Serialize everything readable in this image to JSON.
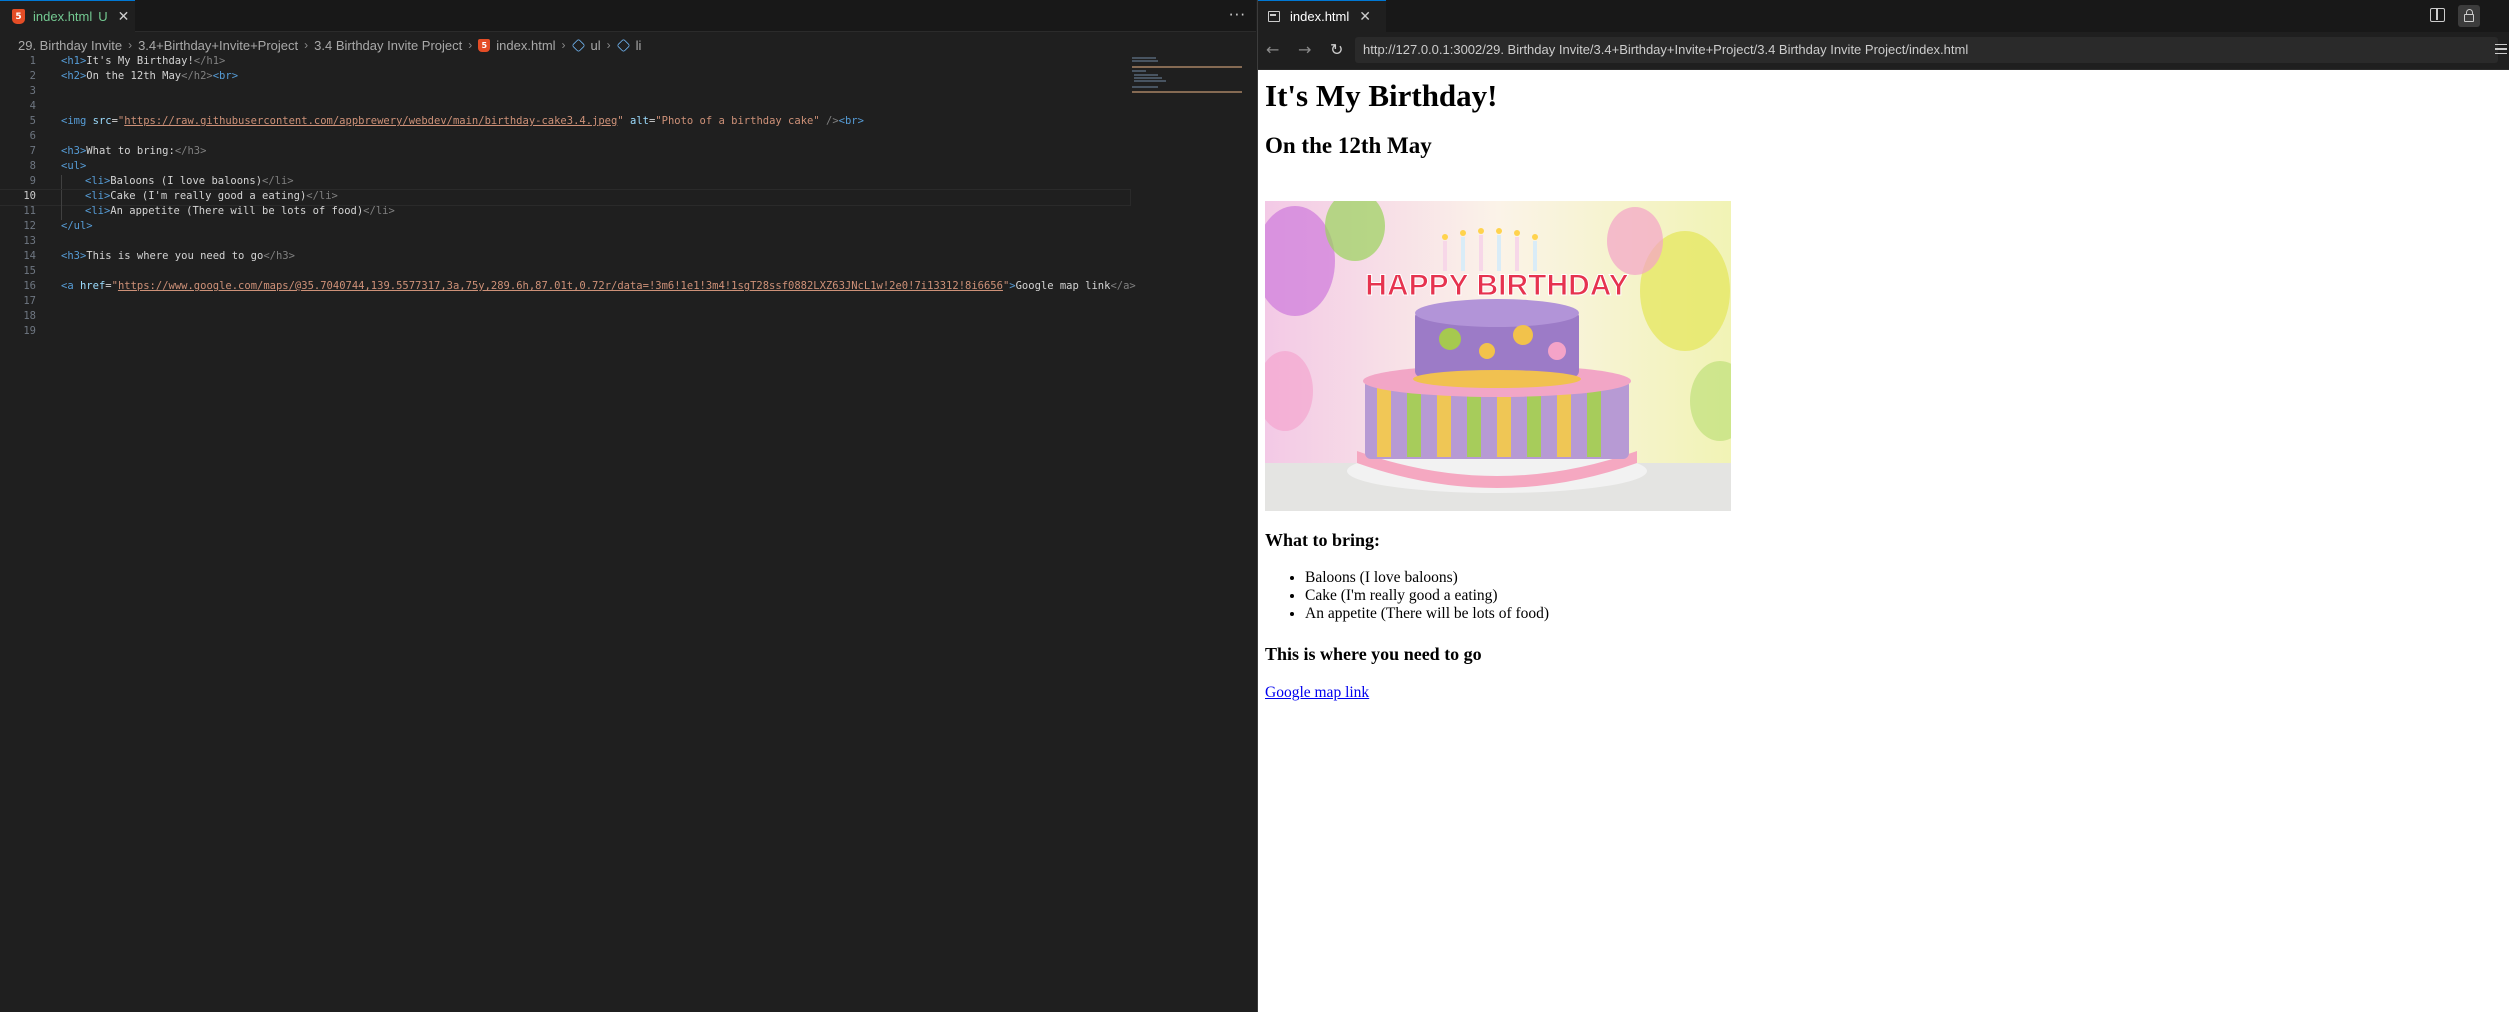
{
  "editor": {
    "tab_label": "index.html",
    "tab_badge": "U",
    "breadcrumb": [
      "29. Birthday Invite",
      "3.4+Birthday+Invite+Project",
      "3.4 Birthday Invite Project",
      "index.html",
      "ul",
      "li"
    ],
    "line_numbers": [
      "1",
      "2",
      "3",
      "4",
      "5",
      "6",
      "7",
      "8",
      "9",
      "10",
      "11",
      "12",
      "13",
      "14",
      "15",
      "16",
      "17",
      "18",
      "19"
    ],
    "current_line": 10,
    "lines": {
      "l1_text": "It's My Birthday!",
      "l2_text": "On the 12th May",
      "l5_src": "https://raw.githubusercontent.com/appbrewery/webdev/main/birthday-cake3.4.jpeg",
      "l5_alt": "Photo of a birthday cake",
      "l7_text": "What to bring:",
      "l9_text": "Baloons (I love baloons)",
      "l10_text": "Cake (I'm really good a eating)",
      "l11_text": "An appetite (There will be lots of food)",
      "l14_text": "This is where you need to go",
      "l16_href": "https://www.google.com/maps/@35.7040744,139.5577317,3a,75y,289.6h,87.01t,0.72r/data=!3m6!1e1!3m4!1sgT28ssf0882LXZ63JNcL1w!2e0!7i13312!8i6656",
      "l16_text": "Google map link"
    }
  },
  "browser": {
    "tab_label": "index.html",
    "url": "http://127.0.0.1:3002/29. Birthday Invite/3.4+Birthday+Invite+Project/3.4 Birthday Invite Project/index.html",
    "page": {
      "h1": "It's My Birthday!",
      "h2": "On the 12th May",
      "img_alt": "Photo of a birthday cake",
      "cake_topper_text": "HAPPY BIRTHDAY",
      "h3_bring": "What to bring:",
      "items": [
        "Baloons (I love baloons)",
        "Cake (I'm really good a eating)",
        "An appetite (There will be lots of food)"
      ],
      "h3_go": "This is where you need to go",
      "link_text": "Google map link"
    }
  }
}
